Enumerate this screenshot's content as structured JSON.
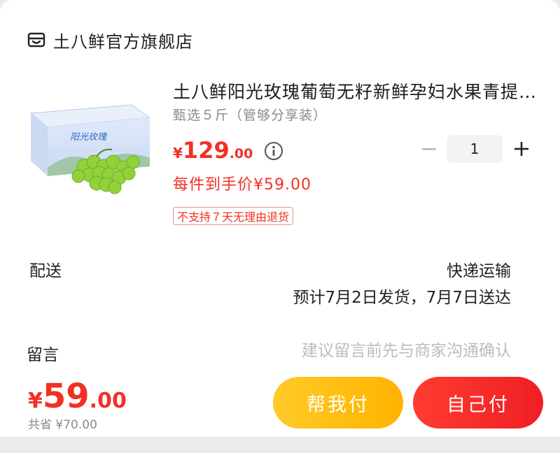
{
  "store": {
    "name": "土八鲜官方旗舰店",
    "icon": "store-icon"
  },
  "product": {
    "title": "土八鲜阳光玫瑰葡萄无籽新鲜孕妇水果青提...",
    "spec": "甄选５斤（管够分享装）",
    "price": {
      "currency": "¥",
      "integer": "129",
      "decimal": ".00"
    },
    "net_price": "每件到手价¥59.00",
    "badge": "不支持７天无理由退货",
    "quantity": "1",
    "image_label": "阳光玫瑰"
  },
  "delivery": {
    "label": "配送",
    "method": "快递运输",
    "eta": "预计7月2日发货，7月7日送达"
  },
  "message": {
    "label": "留言",
    "placeholder": "建议留言前先与商家沟通确认"
  },
  "footer": {
    "total": {
      "currency": "¥",
      "integer": "59",
      "decimal": ".00"
    },
    "saved": "共省 ¥70.00",
    "help_pay_label": "帮我付",
    "self_pay_label": "自己付"
  },
  "colors": {
    "accent_red": "#f23024",
    "help_yellow": "#ffc107",
    "pay_red": "#ef1f25"
  }
}
